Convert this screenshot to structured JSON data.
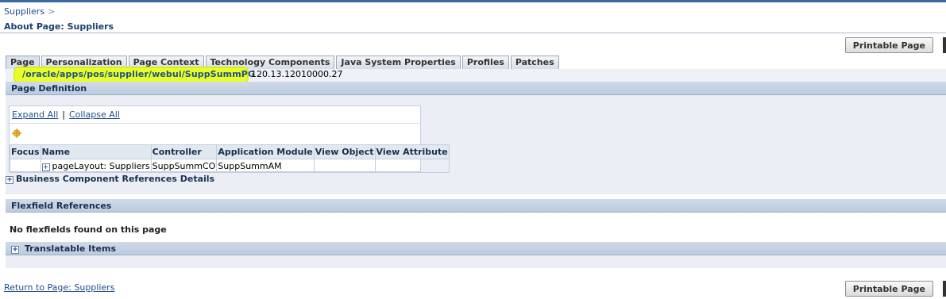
{
  "breadcrumb": {
    "link": "Suppliers",
    "sep": ">"
  },
  "page_title": "About Page: Suppliers",
  "printable_label": "Printable Page",
  "tabs": [
    {
      "label": "Page"
    },
    {
      "label": "Personalization"
    },
    {
      "label": "Page Context"
    },
    {
      "label": "Technology Components"
    },
    {
      "label": "Java System Properties"
    },
    {
      "label": "Profiles"
    },
    {
      "label": "Patches"
    }
  ],
  "page_path": "/oracle/apps/pos/supplier/webui/SuppSummPG",
  "page_version": "120.13.12010000.27",
  "sections": {
    "page_definition": "Page Definition",
    "business_component": "Business Component References Details",
    "flexfield": "Flexfield References",
    "flexfield_msg": "No flexfields found on this page",
    "translatable": "Translatable Items"
  },
  "tree": {
    "expand_all": "Expand All",
    "collapse_all": "Collapse All",
    "separator": "|",
    "columns": [
      "Focus",
      "Name",
      "Controller",
      "Application Module",
      "View Object",
      "View Attribute"
    ],
    "row": {
      "name": "pageLayout: Suppliers",
      "controller": "SuppSummCO",
      "app_module": "SuppSummAM",
      "view_object": "",
      "view_attribute": ""
    }
  },
  "return_link": "Return to Page: Suppliers",
  "colors": {
    "link": "#1f4e8a",
    "highlight": "#e8ff2a",
    "section_header": "#c5d3e4"
  }
}
